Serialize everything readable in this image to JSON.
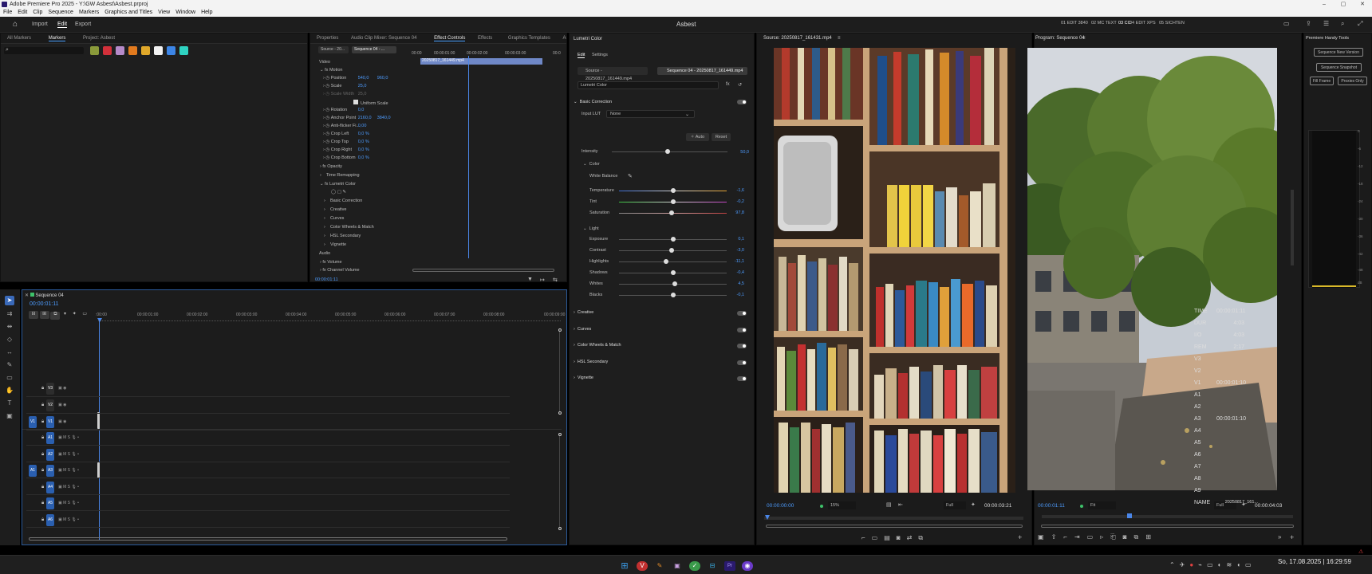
{
  "title_bar": {
    "title": "Adobe Premiere Pro 2025 - Y:\\GW Asbest\\Asbest.prproj",
    "minimize": "–",
    "maximize": "▢",
    "close": "✕"
  },
  "menu": [
    "File",
    "Edit",
    "Clip",
    "Sequence",
    "Markers",
    "Graphics and Titles",
    "View",
    "Window",
    "Help"
  ],
  "header": {
    "tabs": [
      "Import",
      "Edit",
      "Export"
    ],
    "active_tab": "Edit",
    "project_name": "Asbest",
    "workspaces": [
      "01 EDIT 3840",
      "02 MC TEXT",
      "03 CC",
      "04 EDIT XPS",
      "05 SICHTEN"
    ],
    "active_workspace": "03 CC"
  },
  "markers_panel": {
    "tabs": [
      "All Markers",
      "Markers",
      "Project: Asbest"
    ],
    "active": "Markers",
    "colors": [
      "#8a9a3a",
      "#d2303a",
      "#b58ac9",
      "#e27a1e",
      "#e0a82a",
      "#f2f2f2",
      "#3c85e6",
      "#2fd3c2"
    ]
  },
  "effect_controls": {
    "tabs": [
      "Properties",
      "Audio Clip Mixer: Sequence 04",
      "Effect Controls",
      "Effects",
      "Graphics Templates",
      "Au"
    ],
    "active": "Effect Controls",
    "source_tab": "Source - 20...",
    "seq_tab": "Sequence 04 - ...",
    "clip_name": "20250817_161449.mp4",
    "ruler": [
      "00:00",
      "00:00:01:00",
      "00:00:02:00",
      "00:00:03:00",
      "00:0"
    ],
    "video_label": "Video",
    "audio_label": "Audio",
    "motion": "Motion",
    "props": [
      {
        "name": "Position",
        "v1": "540,0",
        "v2": "960,0"
      },
      {
        "name": "Scale",
        "v1": "25,0",
        "v2": ""
      },
      {
        "name": "Scale Width",
        "v1": "25,0",
        "v2": ""
      },
      {
        "name": "Rotation",
        "v1": "0,0",
        "v2": ""
      },
      {
        "name": "Anchor Point",
        "v1": "2160,0",
        "v2": "3840,0"
      },
      {
        "name": "Anti-flicker Fi...",
        "v1": "0,00",
        "v2": ""
      },
      {
        "name": "Crop Left",
        "v1": "0,0 %",
        "v2": ""
      },
      {
        "name": "Crop Top",
        "v1": "0,0 %",
        "v2": ""
      },
      {
        "name": "Crop Right",
        "v1": "0,0 %",
        "v2": ""
      },
      {
        "name": "Crop Bottom",
        "v1": "0,0 %",
        "v2": ""
      }
    ],
    "uniform_scale": "Uniform Scale",
    "opacity": "Opacity",
    "time_remap": "Time Remapping",
    "lumetri": "Lumetri Color",
    "lumetri_sub": [
      "Basic Correction",
      "Creative",
      "Curves",
      "Color Wheels & Match",
      "HSL Secondary",
      "Vignette"
    ],
    "volume": "Volume",
    "channel_volume": "Channel Volume",
    "timecode": "00:00:01:11"
  },
  "lumetri": {
    "title": "Lumetri Color",
    "tabs": [
      "Edit",
      "Settings"
    ],
    "source_sel": "Source - 20250817_161449.mp4",
    "seq_sel": "Sequence 04 - 20250817_161449.mp4",
    "effect_sel": "Lumetri Color",
    "basic": "Basic Correction",
    "input_lut_label": "Input LUT",
    "input_lut": "None",
    "auto": "Auto",
    "reset": "Reset",
    "intensity_label": "Intensity",
    "intensity": "50,0",
    "color_section": "Color",
    "white_balance": "White Balance",
    "color_sliders": [
      {
        "name": "Temperature",
        "value": "-1,6",
        "pos": 0.5
      },
      {
        "name": "Tint",
        "value": "-0,2",
        "pos": 0.5
      },
      {
        "name": "Saturation",
        "value": "97,8",
        "pos": 0.49
      }
    ],
    "light_section": "Light",
    "light_sliders": [
      {
        "name": "Exposure",
        "value": "0,1",
        "pos": 0.5
      },
      {
        "name": "Contrast",
        "value": "-3,0",
        "pos": 0.49
      },
      {
        "name": "Highlights",
        "value": "-11,1",
        "pos": 0.44
      },
      {
        "name": "Shadows",
        "value": "-0,4",
        "pos": 0.5
      },
      {
        "name": "Whites",
        "value": "4,5",
        "pos": 0.52
      },
      {
        "name": "Blacks",
        "value": "-0,1",
        "pos": 0.5
      }
    ],
    "sections": [
      "Creative",
      "Curves",
      "Color Wheels & Match",
      "HSL Secondary",
      "Vignette"
    ]
  },
  "source_monitor": {
    "title": "Source: 20250817_161431.mp4",
    "timecode": "00:00:00:00",
    "zoom": "15%",
    "quality": "Full",
    "duration": "00:00:03:21"
  },
  "program_monitor": {
    "title": "Program: Sequence 04",
    "timecode": "00:00:01:11",
    "fit": "Fit",
    "quality": "Full",
    "duration": "00:00:04:03"
  },
  "handy_tools": {
    "title": "Premiere Handy Tools",
    "buttons": [
      "Sequence New Version",
      "Sequence Snapshot",
      "Fill Frame",
      "Proxies Only"
    ]
  },
  "meter_scale": [
    "0",
    "-6",
    "-12",
    "-18",
    "-24",
    "-30",
    "-36",
    "-42",
    "-48",
    "dB"
  ],
  "info": [
    {
      "k": "TIME",
      "v": "00:00:01:11"
    },
    {
      "k": "DUR",
      "v": "4:03"
    },
    {
      "k": "I/O",
      "v": "4:03"
    },
    {
      "k": "REM",
      "v": "2:17"
    },
    {
      "k": "V3",
      "v": ""
    },
    {
      "k": "V2",
      "v": ""
    },
    {
      "k": "V1",
      "v": "00:00:01:10"
    },
    {
      "k": "A1",
      "v": ""
    },
    {
      "k": "A2",
      "v": ""
    },
    {
      "k": "A3",
      "v": "00:00:01:10"
    },
    {
      "k": "A4",
      "v": ""
    },
    {
      "k": "A5",
      "v": ""
    },
    {
      "k": "A6",
      "v": ""
    },
    {
      "k": "A7",
      "v": ""
    },
    {
      "k": "A8",
      "v": ""
    },
    {
      "k": "A9",
      "v": ""
    },
    {
      "k": "NAME",
      "v": "20250817_161..."
    }
  ],
  "timeline": {
    "title": "Sequence 04",
    "timecode": "00:00:01:11",
    "ruler": [
      ":00:00",
      "00:00:01:00",
      "00:00:02:00",
      "00:00:03:00",
      "00:00:04:00",
      "00:00:05:00",
      "00:00:06:00",
      "00:00:07:00",
      "00:00:08:00",
      "00:00:09:00"
    ],
    "video_tracks": [
      "V3",
      "V2",
      "V1"
    ],
    "audio_tracks": [
      "A1",
      "A2",
      "A3",
      "A4",
      "A5",
      "A6"
    ]
  },
  "taskbar": {
    "date": "So, 17.08.2025",
    "time": "16:29:59"
  }
}
